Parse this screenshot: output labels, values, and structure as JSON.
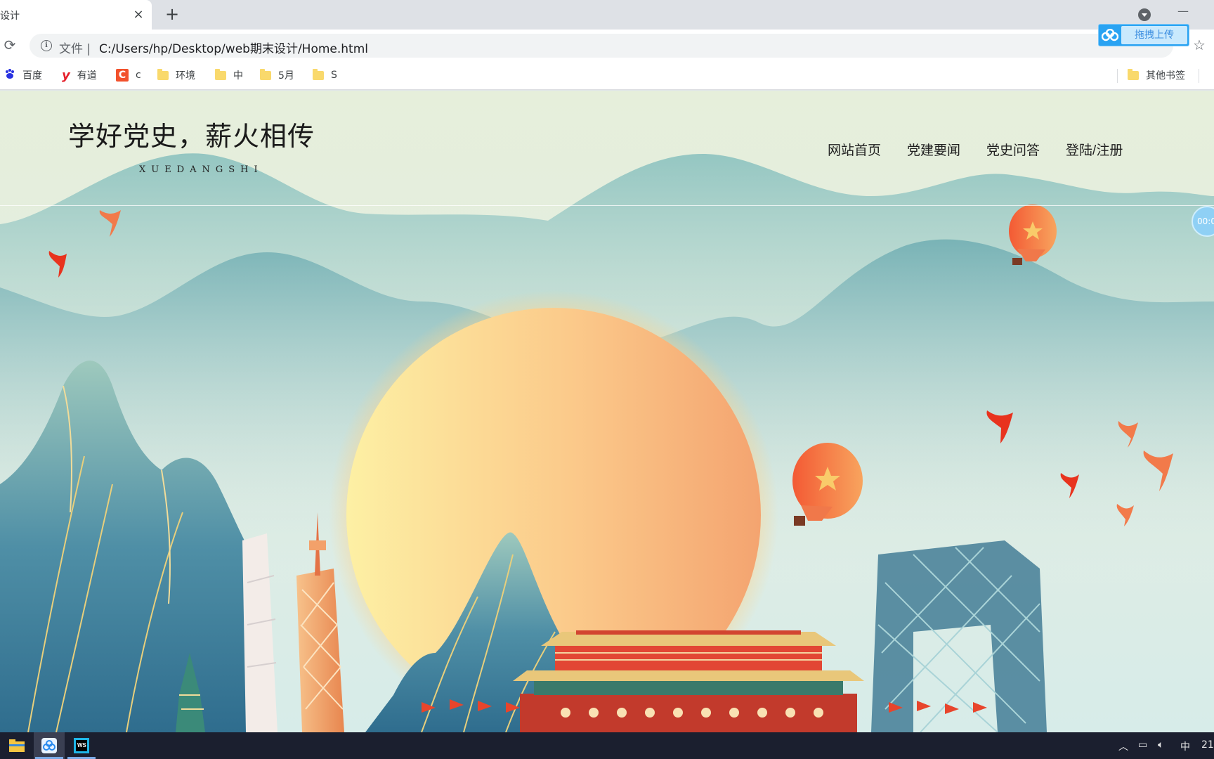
{
  "browser": {
    "tab_title": "设计",
    "tab_close": "×",
    "new_tab": "+",
    "address": {
      "scheme_label": "文件",
      "separator": "|",
      "url": "C:/Users/hp/Desktop/web期末设计/Home.html"
    },
    "upload_button": "拖拽上传",
    "bookmarks": [
      {
        "label": "百度",
        "icon": "baidu-icon"
      },
      {
        "label": "有道",
        "icon": "youdao-icon"
      },
      {
        "label": "c",
        "icon": "c-icon"
      },
      {
        "label": "环境",
        "icon": "folder-icon"
      },
      {
        "label": "中",
        "icon": "folder-icon"
      },
      {
        "label": "5月",
        "icon": "folder-icon"
      },
      {
        "label": "S",
        "icon": "folder-icon"
      }
    ],
    "other_bookmarks": "其他书签"
  },
  "site": {
    "title": "学好党史，薪火相传",
    "subtitle": "XUEDANGSHI",
    "nav": [
      "网站首页",
      "党建要闻",
      "党史问答",
      "登陆/注册"
    ]
  },
  "overlay": {
    "timer": "00:0"
  },
  "taskbar": {
    "apps": [
      "file-explorer-icon",
      "baidu-netdisk-icon",
      "webstorm-icon"
    ],
    "ime": "中",
    "clock": "21"
  },
  "colors": {
    "sky": "#e4eedc",
    "sun_inner": "#fde9a0",
    "sun_outer": "#f5a66f",
    "mountain_far": "#86bfbd",
    "mountain_near": "#3f7f9a",
    "gold": "#e8cf7c",
    "red": "#e8452c",
    "taskbar": "#1b1f2f"
  }
}
